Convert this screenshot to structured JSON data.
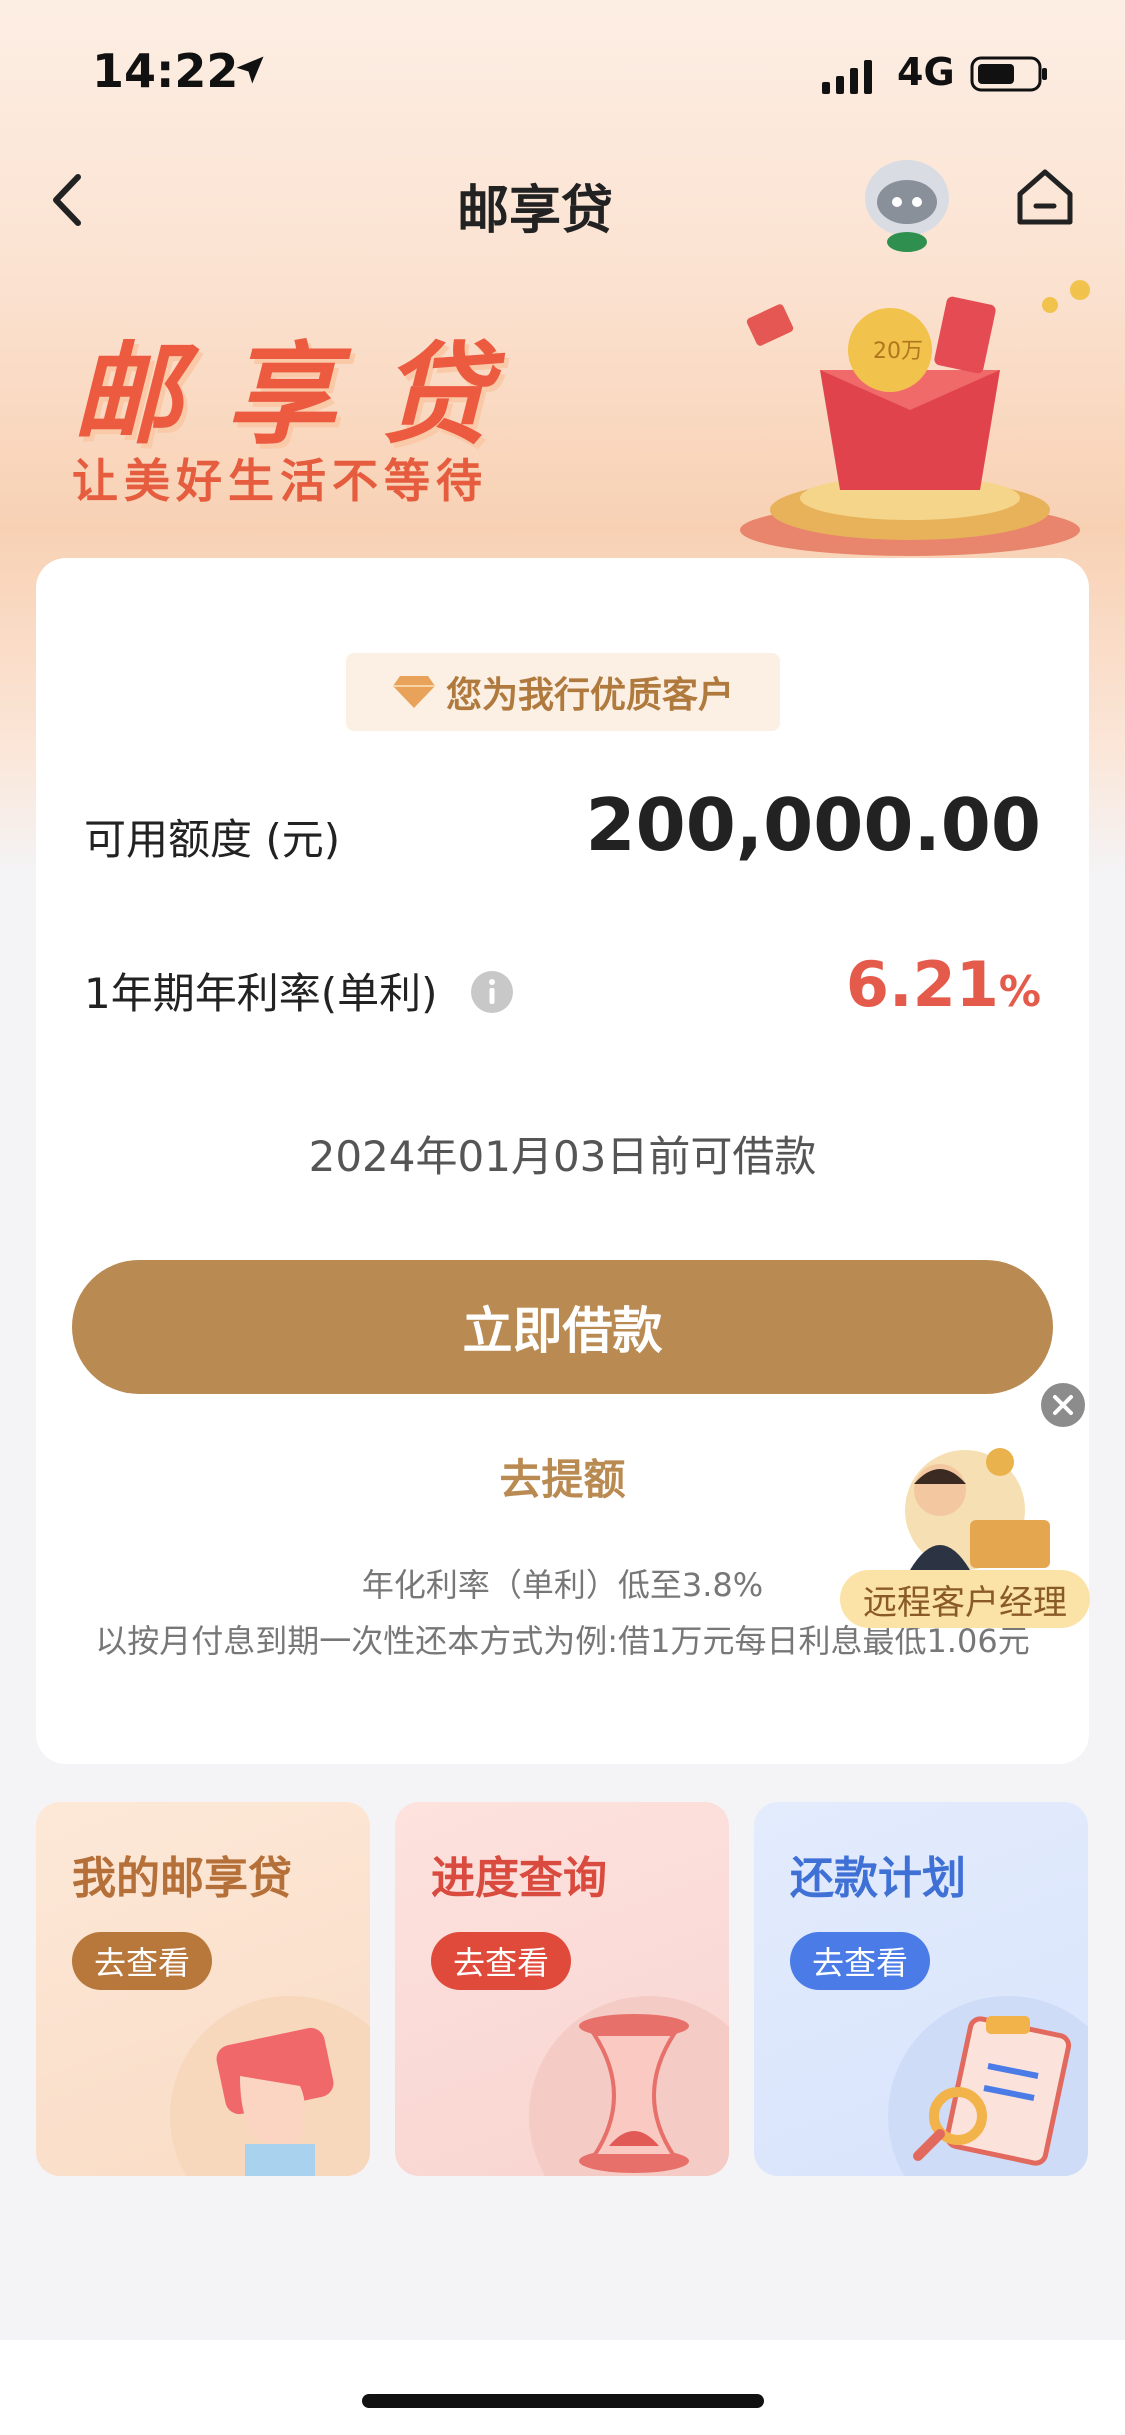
{
  "status_bar": {
    "time": "14:22",
    "network": "4G"
  },
  "nav": {
    "title": "邮享贷"
  },
  "banner": {
    "title": "邮享贷",
    "slogan": "让美好生活不等待",
    "gift_text": "20万"
  },
  "card": {
    "vip_badge": "您为我行优质客户",
    "credit_label": "可用额度 (元)",
    "credit_value": "200,000.00",
    "rate_label": "1年期年利率(单利)",
    "rate_value": "6.21",
    "rate_unit": "%",
    "deadline": "2024年01月03日前可借款",
    "borrow_button": "立即借款",
    "raise_link": "去提额",
    "disclaimer_1": "年化利率（单利）低至3.8%",
    "disclaimer_2": "以按月付息到期一次性还本方式为例:借1万元每日利息最低1.06元"
  },
  "floating_manager": {
    "label": "远程客户经理"
  },
  "tiles": [
    {
      "title": "我的邮享贷",
      "button": "去查看"
    },
    {
      "title": "进度查询",
      "button": "去查看"
    },
    {
      "title": "还款计划",
      "button": "去查看"
    }
  ],
  "colors": {
    "accent_gold": "#b98a52",
    "rate_red": "#e45b4b",
    "banner_red": "#ec5a3f"
  }
}
